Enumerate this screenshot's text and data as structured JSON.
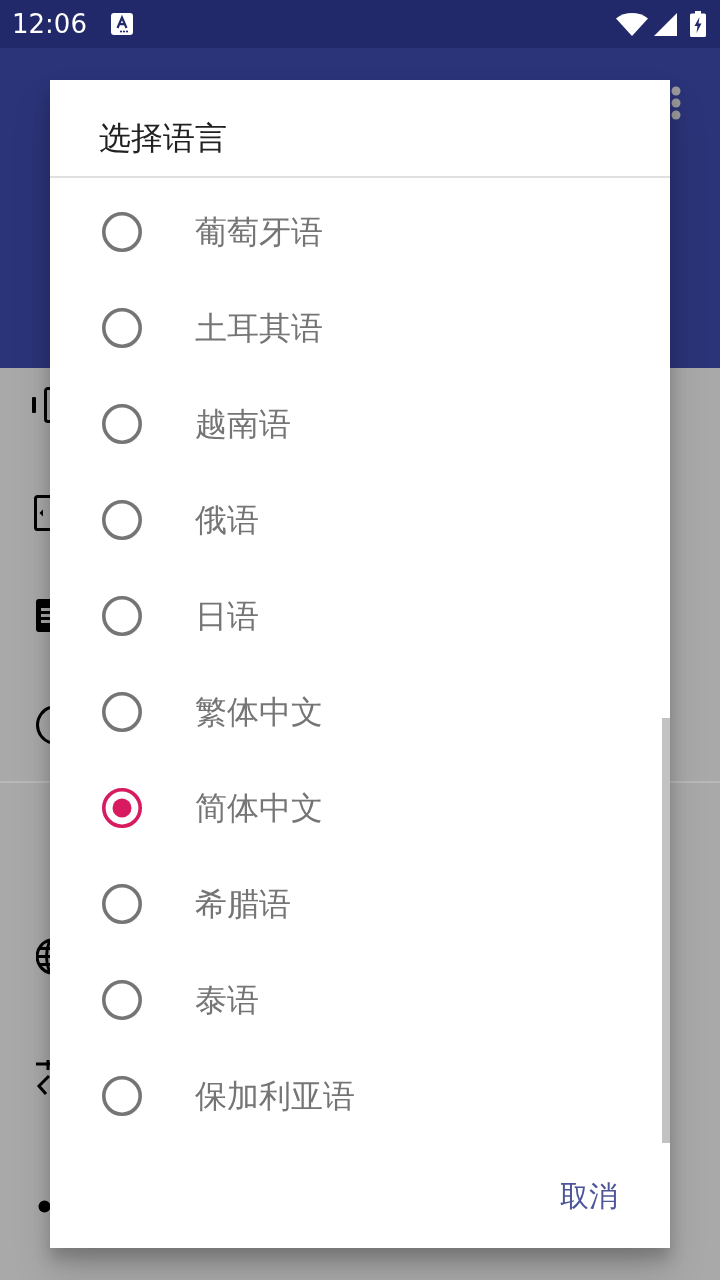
{
  "status_bar": {
    "time": "12:06"
  },
  "dialog": {
    "title": "选择语言",
    "options": [
      {
        "label": "葡萄牙语",
        "selected": false
      },
      {
        "label": "土耳其语",
        "selected": false
      },
      {
        "label": "越南语",
        "selected": false
      },
      {
        "label": "俄语",
        "selected": false
      },
      {
        "label": "日语",
        "selected": false
      },
      {
        "label": "繁体中文",
        "selected": false
      },
      {
        "label": "简体中文",
        "selected": true
      },
      {
        "label": "希腊语",
        "selected": false
      },
      {
        "label": "泰语",
        "selected": false
      },
      {
        "label": "保加利亚语",
        "selected": false
      }
    ],
    "cancel_button": {
      "label": "取消"
    }
  }
}
